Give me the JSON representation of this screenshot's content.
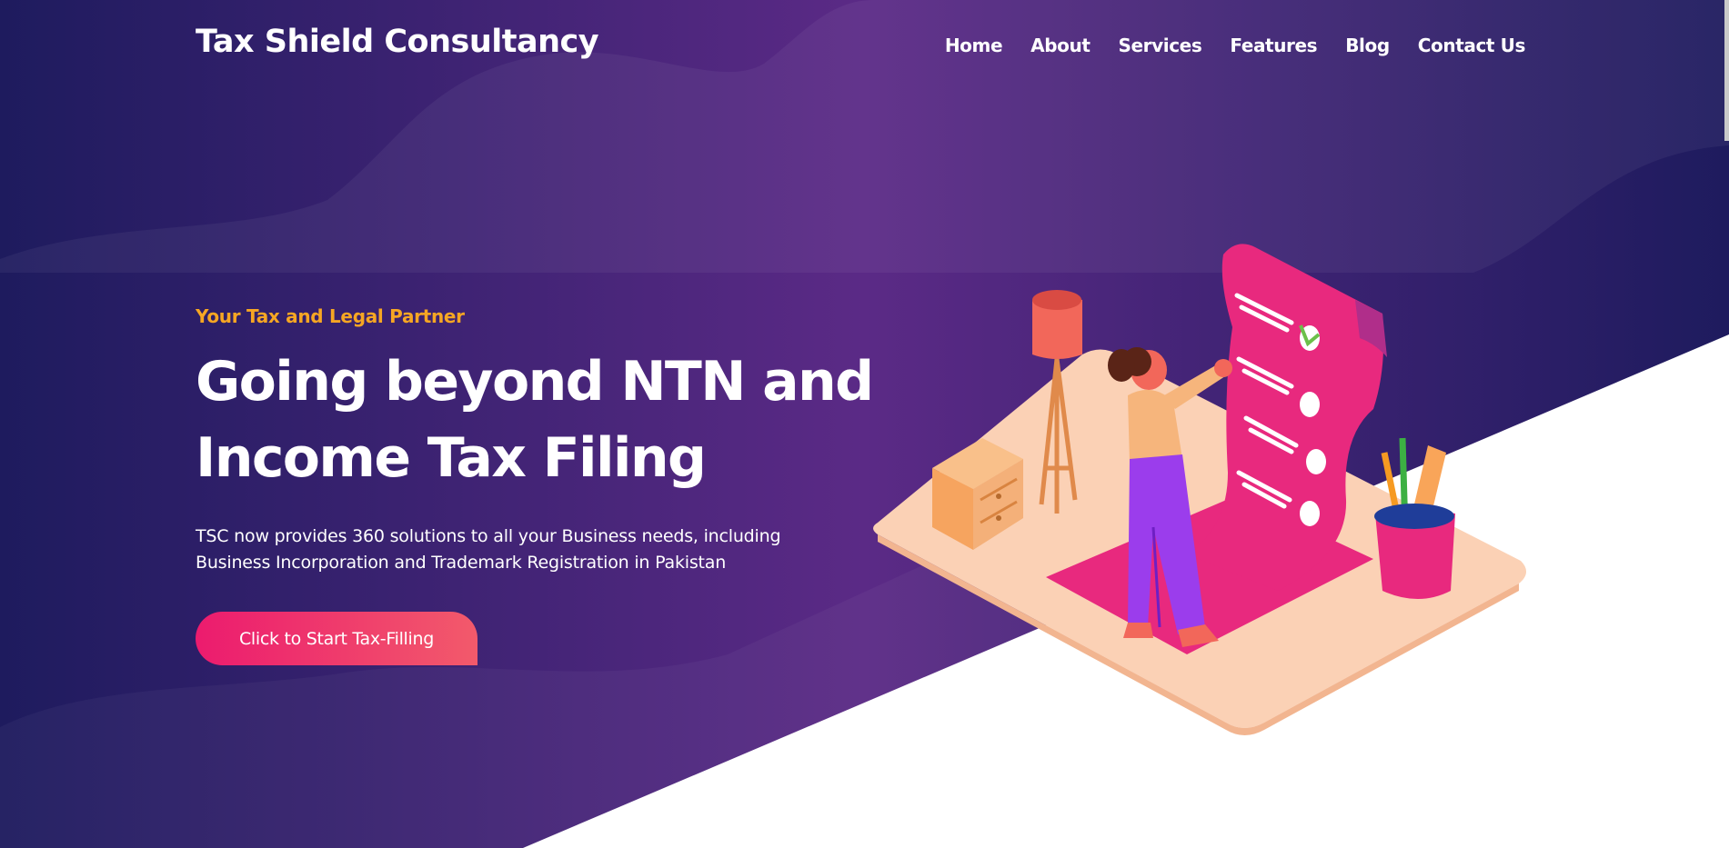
{
  "navbar": {
    "brand": "Tax Shield Consultancy",
    "links": [
      "Home",
      "About",
      "Services",
      "Features",
      "Blog",
      "Contact Us"
    ]
  },
  "hero": {
    "tagline": "Your Tax and Legal Partner",
    "headline_line1": "Going beyond NTN and",
    "headline_line2": "Income Tax Filing",
    "description_line1": "TSC now provides 360 solutions to all your Business needs, including",
    "description_line2": "Business Incorporation and Trademark Registration in Pakistan",
    "cta_label": "Click to Start Tax-Filling"
  },
  "illustration": {
    "icon": "tax-checklist-illustration"
  },
  "colors": {
    "hero_dark": "#1e1b5e",
    "hero_purple": "#5b2a86",
    "accent_orange": "#f6a623",
    "accent_pink": "#e8297e",
    "cta_start": "#ec1b6e",
    "cta_end": "#f25a6b"
  }
}
